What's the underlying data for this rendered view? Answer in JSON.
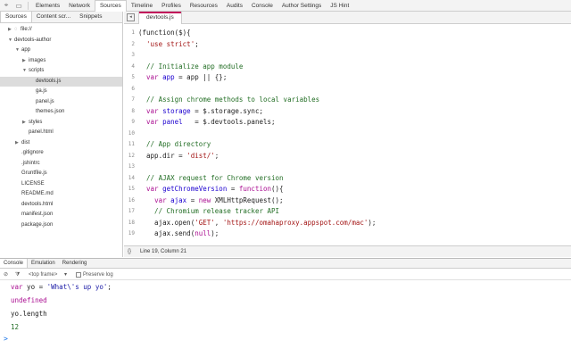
{
  "toolbar": {
    "tabs": [
      "Elements",
      "Network",
      "Sources",
      "Timeline",
      "Profiles",
      "Resources",
      "Audits",
      "Console",
      "Author Settings",
      "JS Hint"
    ],
    "active_tab": "Sources"
  },
  "navigator": {
    "tabs": [
      "Sources",
      "Content scr...",
      "Snippets"
    ],
    "active_tab": "Sources",
    "tree": [
      {
        "label": "file://",
        "expanded": false,
        "has_children": true
      },
      {
        "label": "devtools-author",
        "expanded": true,
        "has_children": true
      },
      {
        "label": "app",
        "expanded": true,
        "has_children": true
      },
      {
        "label": "images",
        "expanded": false,
        "has_children": true
      },
      {
        "label": "scripts",
        "expanded": true,
        "has_children": true
      },
      {
        "label": "devtools.js",
        "selected": true
      },
      {
        "label": "ga.js"
      },
      {
        "label": "panel.js"
      },
      {
        "label": "themes.json"
      },
      {
        "label": "styles",
        "expanded": false,
        "has_children": true
      },
      {
        "label": "panel.html"
      },
      {
        "label": "dist",
        "expanded": false,
        "has_children": true
      },
      {
        "label": ".gitignore"
      },
      {
        "label": ".jshintrc"
      },
      {
        "label": "Gruntfile.js"
      },
      {
        "label": "LICENSE"
      },
      {
        "label": "README.md"
      },
      {
        "label": "devtools.html"
      },
      {
        "label": "manifest.json"
      },
      {
        "label": "package.json"
      }
    ]
  },
  "editor": {
    "file_tab": "devtools.js",
    "lines": [
      {
        "n": "1",
        "parts": [
          [
            "plain",
            "(function($){"
          ]
        ]
      },
      {
        "n": "2",
        "parts": [
          [
            "plain",
            "  "
          ],
          [
            "str2",
            "'use strict'"
          ],
          [
            "plain",
            ";"
          ]
        ]
      },
      {
        "n": "3",
        "parts": []
      },
      {
        "n": "4",
        "parts": [
          [
            "com",
            "  // Initialize app module"
          ]
        ]
      },
      {
        "n": "5",
        "parts": [
          [
            "plain",
            "  "
          ],
          [
            "kw",
            "var"
          ],
          [
            "plain",
            " "
          ],
          [
            "def",
            "app"
          ],
          [
            "plain",
            " = app || {};"
          ]
        ]
      },
      {
        "n": "6",
        "parts": []
      },
      {
        "n": "7",
        "parts": [
          [
            "com",
            "  // Assign chrome methods to local variables"
          ]
        ]
      },
      {
        "n": "8",
        "parts": [
          [
            "plain",
            "  "
          ],
          [
            "kw",
            "var"
          ],
          [
            "plain",
            " "
          ],
          [
            "def",
            "storage"
          ],
          [
            "plain",
            " = $.storage.sync;"
          ]
        ]
      },
      {
        "n": "9",
        "parts": [
          [
            "plain",
            "  "
          ],
          [
            "kw",
            "var"
          ],
          [
            "plain",
            " "
          ],
          [
            "def",
            "panel"
          ],
          [
            "plain",
            "   = $.devtools.panels;"
          ]
        ]
      },
      {
        "n": "10",
        "parts": []
      },
      {
        "n": "11",
        "parts": [
          [
            "com",
            "  // App directory"
          ]
        ]
      },
      {
        "n": "12",
        "parts": [
          [
            "plain",
            "  app.dir = "
          ],
          [
            "str2",
            "'dist/'"
          ],
          [
            "plain",
            ";"
          ]
        ]
      },
      {
        "n": "13",
        "parts": []
      },
      {
        "n": "14",
        "parts": [
          [
            "com",
            "  // AJAX request for Chrome version"
          ]
        ]
      },
      {
        "n": "15",
        "parts": [
          [
            "plain",
            "  "
          ],
          [
            "kw",
            "var"
          ],
          [
            "plain",
            " "
          ],
          [
            "def",
            "getChromeVersion"
          ],
          [
            "plain",
            " = "
          ],
          [
            "kw",
            "function"
          ],
          [
            "plain",
            "(){"
          ]
        ]
      },
      {
        "n": "16",
        "parts": [
          [
            "plain",
            "    "
          ],
          [
            "kw",
            "var"
          ],
          [
            "plain",
            " "
          ],
          [
            "def",
            "ajax"
          ],
          [
            "plain",
            " = "
          ],
          [
            "kw",
            "new"
          ],
          [
            "plain",
            " XMLHttpRequest();"
          ]
        ]
      },
      {
        "n": "17",
        "parts": [
          [
            "com",
            "    // Chromium release tracker API"
          ]
        ]
      },
      {
        "n": "18",
        "parts": [
          [
            "plain",
            "    ajax.open("
          ],
          [
            "str2",
            "'GET'"
          ],
          [
            "plain",
            ", "
          ],
          [
            "str2",
            "'https://omahaproxy.appspot.com/mac'"
          ],
          [
            "plain",
            ");"
          ]
        ]
      },
      {
        "n": "19",
        "parts": [
          [
            "plain",
            "    ajax.send("
          ],
          [
            "kw",
            "null"
          ],
          [
            "plain",
            ");"
          ]
        ]
      }
    ],
    "status": {
      "format_icon": "{}",
      "position": "Line 19, Column 21"
    }
  },
  "drawer": {
    "tabs": [
      "Console",
      "Emulation",
      "Rendering"
    ],
    "active_tab": "Console",
    "toolbar": {
      "frame": "<top frame>",
      "preserve_log": "Preserve log"
    },
    "lines": [
      {
        "kind": "input",
        "parts": [
          [
            "kw",
            "var"
          ],
          [
            "plain",
            " yo = "
          ],
          [
            "str2",
            "'What\\'s up yo'"
          ],
          [
            "plain",
            ";"
          ]
        ]
      },
      {
        "kind": "output",
        "parts": [
          [
            "kw",
            "undefined"
          ]
        ]
      },
      {
        "kind": "input",
        "parts": [
          [
            "plain",
            "yo.length"
          ]
        ]
      },
      {
        "kind": "output",
        "parts": [
          [
            "def2",
            "12"
          ]
        ]
      }
    ],
    "prompt": ">"
  },
  "colors": {
    "accent": "#c2185b",
    "keyword": "#aa0d91",
    "string": "#a31515",
    "comment": "#236e25",
    "number": "#1c00cf"
  }
}
